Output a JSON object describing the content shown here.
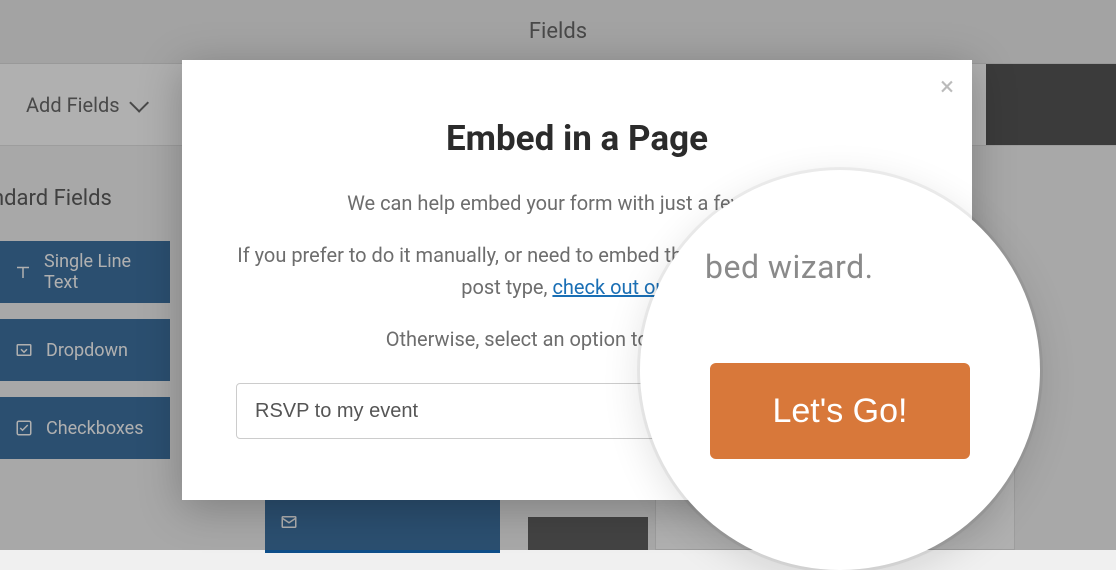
{
  "header": {
    "title": "Fields"
  },
  "toolbar": {
    "add_fields_label": "Add Fields"
  },
  "sidebar": {
    "section_label": "andard Fields",
    "items": [
      {
        "label": "Single Line Text",
        "icon": "text-icon"
      },
      {
        "label": "Dropdown",
        "icon": "dropdown-icon"
      },
      {
        "label": "Checkboxes",
        "icon": "checkbox-icon"
      }
    ]
  },
  "modal": {
    "title": "Embed in a Page",
    "subtitle": "We can help embed your form with just a few clicks!",
    "paragraph_lead": "If you prefer to do it manually, or need to embed the form in a post or custom post type, ",
    "link_text": "check out our vi",
    "paragraph_tail": "Otherwise, select an option to proceed with",
    "input_value": "RSVP to my event",
    "go_label": "Go!"
  },
  "magnifier": {
    "ghost_text": "bed wizard.",
    "button_label": "Let's Go!"
  }
}
